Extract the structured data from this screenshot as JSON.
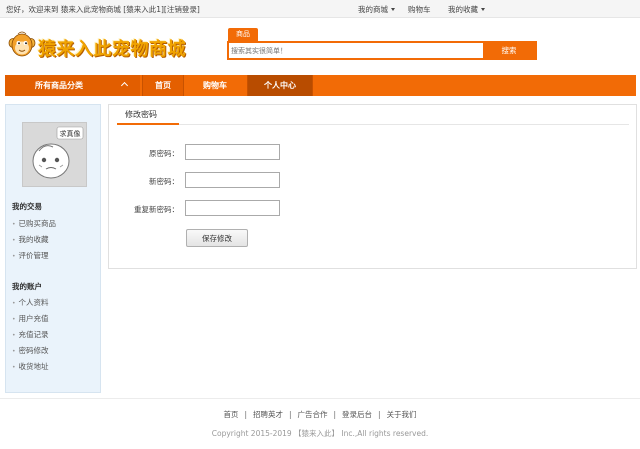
{
  "topbar": {
    "greeting": "您好，欢迎来到 猿来入此宠物商城",
    "user": "[猿来入此1]",
    "logout": "[注销登录]",
    "my_mall": "我的商城",
    "cart": "购物车",
    "favorites": "我的收藏"
  },
  "header": {
    "logo_text": "猿来入此宠物商城",
    "search_tab": "商品",
    "search_placeholder": "搜索其实很简单！",
    "search_button": "搜索"
  },
  "nav": {
    "all_categories": "所有商品分类",
    "items": [
      "首页",
      "购物车",
      "个人中心"
    ]
  },
  "sidebar": {
    "avatar_text": "求真像",
    "section1_title": "我的交易",
    "section1_items": [
      "已购买商品",
      "我的收藏",
      "评价管理"
    ],
    "section2_title": "我的账户",
    "section2_items": [
      "个人资料",
      "用户充值",
      "充值记录",
      "密码修改",
      "收货地址"
    ]
  },
  "main": {
    "title": "修改密码",
    "old_password_label": "原密码：",
    "new_password_label": "新密码：",
    "confirm_password_label": "重复新密码：",
    "save_button": "保存修改"
  },
  "footer": {
    "links": [
      "首页",
      "招聘英才",
      "广告合作",
      "登录后台",
      "关于我们"
    ],
    "copyright": "Copyright 2015-2019 【猿来入此】 Inc.,All rights reserved."
  },
  "colors": {
    "accent": "#f26b06",
    "sidebar_bg": "#eaf3fb"
  }
}
